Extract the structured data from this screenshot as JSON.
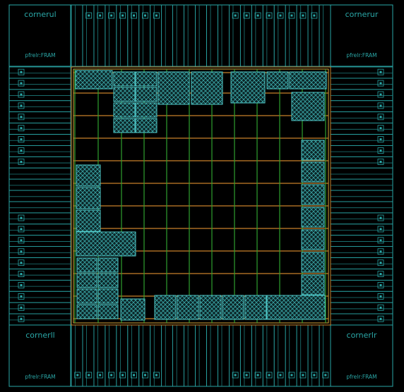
{
  "corners": {
    "ul": {
      "title": "cornerul",
      "subtitle": "pfrelr:FRAM"
    },
    "ur": {
      "title": "cornerur",
      "subtitle": "pfrelr:FRAM"
    },
    "ll": {
      "title": "cornerll",
      "subtitle": "pfrelr:FRAM"
    },
    "lr": {
      "title": "cornerlr",
      "subtitle": "pfrelr:FRAM"
    }
  },
  "colors": {
    "background": "#000000",
    "pad_frame": "#2aa7a7",
    "pad_frame_dim": "#1d7b7b",
    "core_fill": "#3a1d10",
    "metal_h": "#c8802a",
    "metal_v": "#2ea02e",
    "macro_outline": "#4fc7c7",
    "macro_hatch": "#3aa6a6",
    "core_ring": "#d6a238"
  }
}
